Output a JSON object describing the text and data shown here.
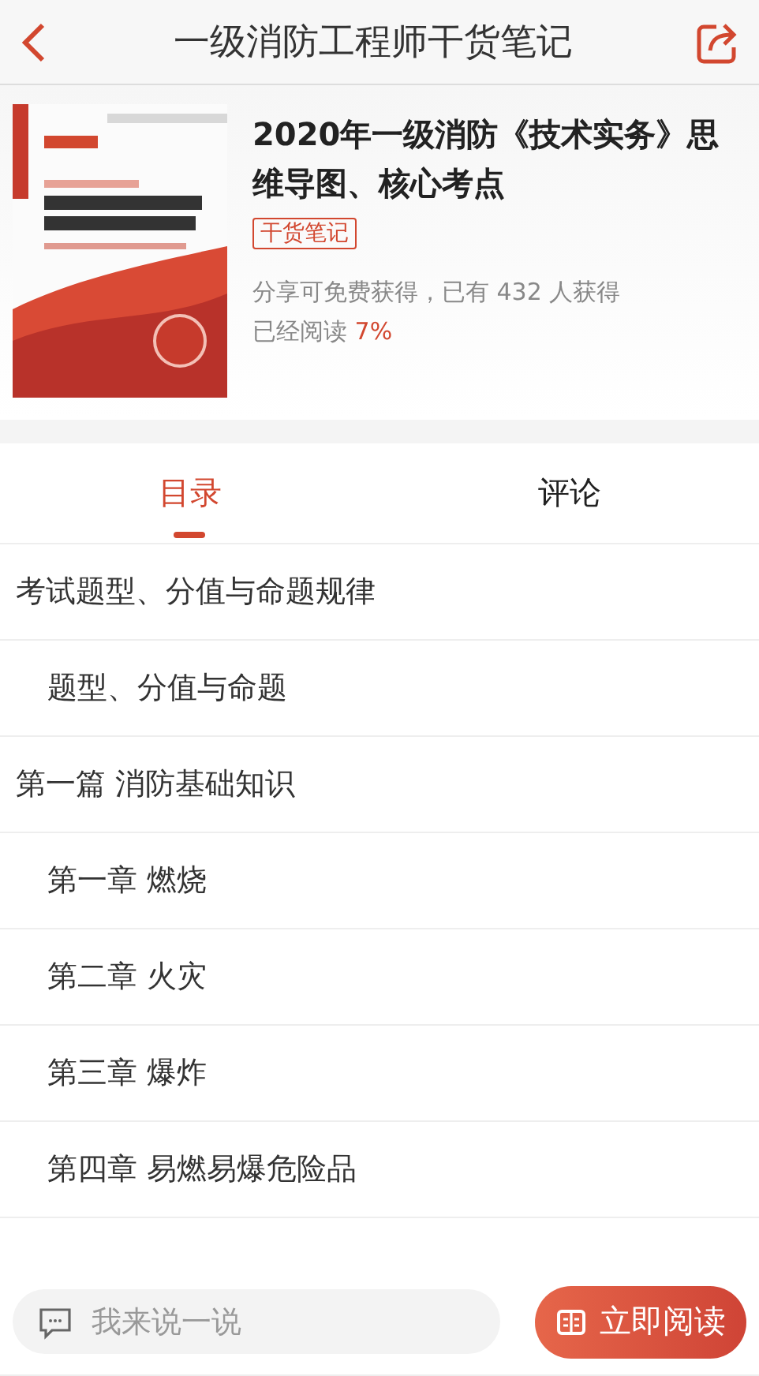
{
  "header": {
    "title": "一级消防工程师干货笔记"
  },
  "book": {
    "title": "2020年一级消防《技术实务》思维导图、核心考点",
    "tag": "干货笔记",
    "share_info": "分享可免费获得，已有 432 人获得",
    "read_label": "已经阅读",
    "read_percent": "7%"
  },
  "tabs": [
    {
      "label": "目录",
      "selected": true
    },
    {
      "label": "评论",
      "selected": false
    }
  ],
  "toc": [
    {
      "label": "考试题型、分值与命题规律",
      "children": [
        {
          "label": "题型、分值与命题"
        }
      ]
    },
    {
      "label": "第一篇 消防基础知识",
      "children": [
        {
          "label": "第一章 燃烧"
        },
        {
          "label": "第二章 火灾"
        },
        {
          "label": "第三章 爆炸"
        },
        {
          "label": "第四章 易燃易爆危险品"
        }
      ]
    }
  ],
  "bottom_bar": {
    "comment_placeholder": "我来说一说",
    "read_button": "立即阅读"
  }
}
